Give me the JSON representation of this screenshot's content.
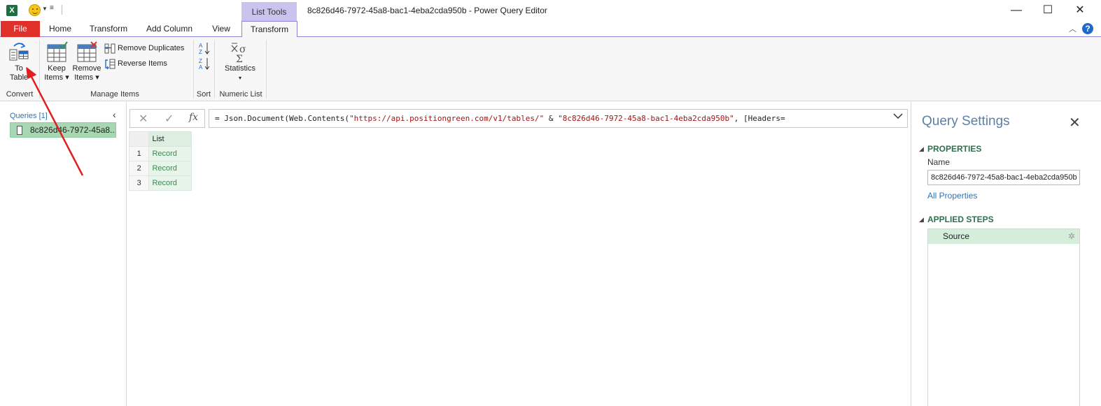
{
  "window": {
    "title": "8c826d46-7972-45a8-bac1-4eba2cda950b - Power Query Editor",
    "context_tab_label": "List Tools",
    "quick_access_more": "≡",
    "minimize": "—",
    "maximize": "☐",
    "close": "✕"
  },
  "tabs": {
    "file": "File",
    "home": "Home",
    "transform": "Transform",
    "add_column": "Add Column",
    "view": "View",
    "list_transform": "Transform",
    "help": "?"
  },
  "ribbon": {
    "convert": {
      "to_table_line1": "To",
      "to_table_line2": "Table",
      "group_label": "Convert"
    },
    "manage_items": {
      "keep_items_line1": "Keep",
      "keep_items_line2": "Items ▾",
      "remove_items_line1": "Remove",
      "remove_items_line2": "Items ▾",
      "remove_duplicates": "Remove Duplicates",
      "reverse_items": "Reverse Items",
      "group_label": "Manage Items"
    },
    "sort": {
      "group_label": "Sort"
    },
    "numeric_list": {
      "statistics_label": "Statistics",
      "statistics_caret": "▾",
      "group_label": "Numeric List"
    }
  },
  "queries": {
    "header": "Queries [1]",
    "items": [
      {
        "label": "8c826d46-7972-45a8..."
      }
    ]
  },
  "formula_bar": {
    "cancel": "✕",
    "confirm": "✓",
    "fx": "fx",
    "part1": "= Json.Document(Web.Contents(",
    "url": "\"https://api.positiongreen.com/v1/tables/\"",
    "part2": " & ",
    "id": "\"8c826d46-7972-45a8-bac1-4eba2cda950b\"",
    "part3": ", [Headers="
  },
  "grid": {
    "column_header": "List",
    "rows": [
      {
        "index": "1",
        "value": "Record"
      },
      {
        "index": "2",
        "value": "Record"
      },
      {
        "index": "3",
        "value": "Record"
      }
    ]
  },
  "query_settings": {
    "title": "Query Settings",
    "properties_title": "PROPERTIES",
    "name_label": "Name",
    "name_value": "8c826d46-7972-45a8-bac1-4eba2cda950b",
    "all_properties": "All Properties",
    "applied_steps_title": "APPLIED STEPS",
    "steps": [
      {
        "label": "Source"
      }
    ]
  },
  "colors": {
    "file_tab": "#e0302a",
    "context_tab": "#c9c3ee",
    "query_selected": "#a8d8b3",
    "record_text": "#3a8a4f",
    "annotation_arrow": "#e02020"
  }
}
